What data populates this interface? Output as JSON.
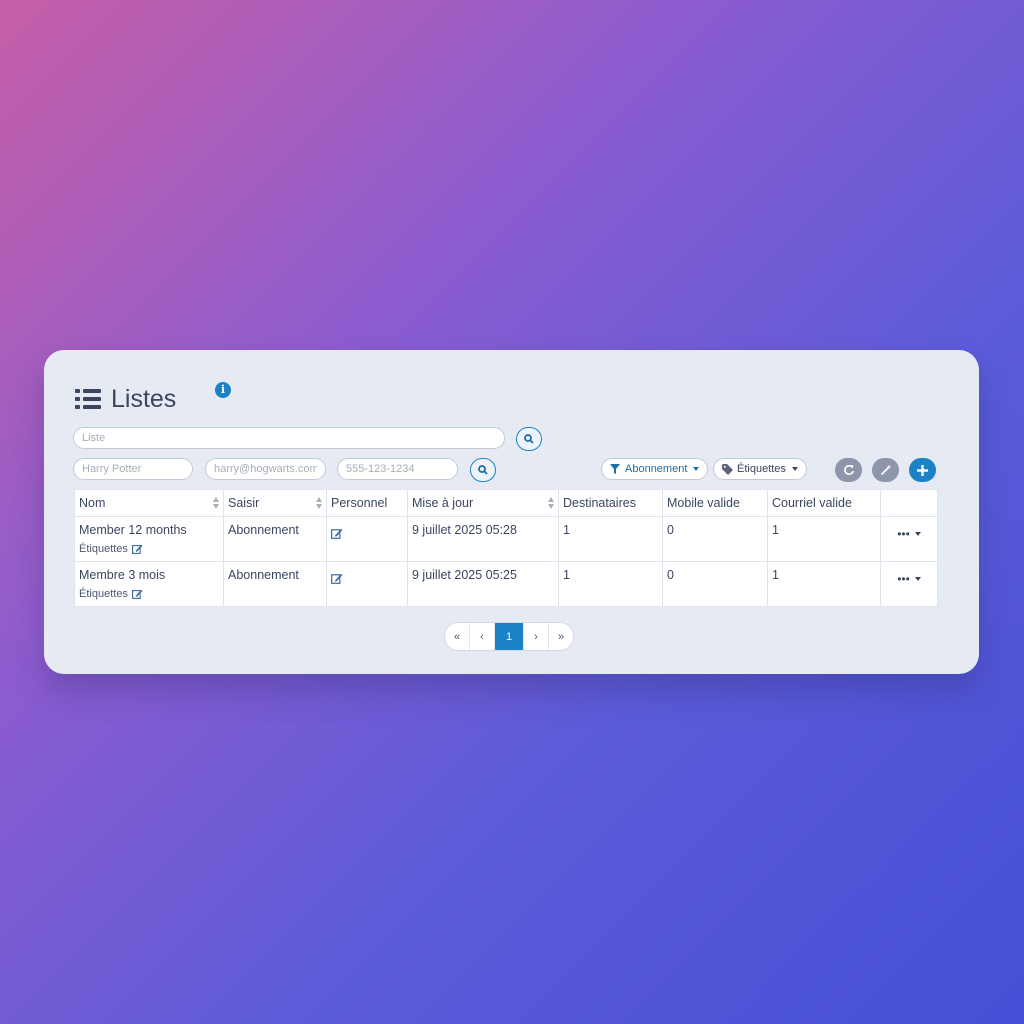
{
  "page": {
    "title": "Listes"
  },
  "search": {
    "list_placeholder": "Liste"
  },
  "filters": {
    "name_placeholder": "Harry Potter",
    "email_placeholder": "harry@hogwarts.com",
    "phone_placeholder": "555-123-1234",
    "subscription_label": "Abonnement",
    "tags_label": "Étiquettes"
  },
  "table": {
    "headers": [
      "Nom",
      "Saisir",
      "Personnel",
      "Mise à jour",
      "Destinataires",
      "Mobile valide",
      "Courriel valide"
    ],
    "tags_label": "Étiquettes",
    "rows": [
      {
        "name": "Member 12 months",
        "type": "Abonnement",
        "updated": "9 juillet 2025 05:28",
        "recipients": "1",
        "mobile_valid": "0",
        "email_valid": "1"
      },
      {
        "name": "Membre 3 mois",
        "type": "Abonnement",
        "updated": "9 juillet 2025 05:25",
        "recipients": "1",
        "mobile_valid": "0",
        "email_valid": "1"
      }
    ]
  },
  "pagination": {
    "first": "«",
    "prev": "‹",
    "current": "1",
    "next": "›",
    "last": "»"
  },
  "colors": {
    "accent": "#1b82c5",
    "text": "#3b4660",
    "card": "#e6ebf3",
    "muted_button": "#8e96ab"
  }
}
